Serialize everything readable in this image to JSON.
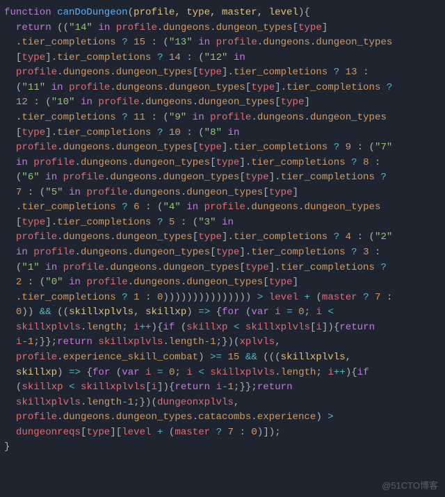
{
  "watermark": "@51CTO博客",
  "code": {
    "l1": {
      "kw1": "function",
      "fn": "canDoDungeon",
      "args": "profile, type, master, level"
    },
    "l2": {
      "kw": "return",
      "s": "\"14\"",
      "in": "in",
      "p1": "profile",
      "d": "dungeons",
      "dt": "dungeon_types",
      "t": "type"
    },
    "l3": {
      "tc": "tier_completions",
      "n15": "15",
      "s13": "\"13\"",
      "in": "in",
      "p": "profile",
      "d": "dungeons",
      "dt": "dungeon_types"
    },
    "l4": {
      "t": "type",
      "tc": "tier_completions",
      "n14": "14",
      "s12": "\"12\"",
      "in": "in"
    },
    "l5": {
      "p": "profile",
      "d": "dungeons",
      "dt": "dungeon_types",
      "t": "type",
      "tc": "tier_completions",
      "n13": "13"
    },
    "l6": {
      "s11": "\"11\"",
      "in": "in",
      "p": "profile",
      "d": "dungeons",
      "dt": "dungeon_types",
      "t": "type",
      "tc": "tier_completions"
    },
    "l7": {
      "n12": "12",
      "s10": "\"10\"",
      "in": "in",
      "p": "profile",
      "d": "dungeons",
      "dt": "dungeon_types",
      "t": "type"
    },
    "l8": {
      "tc": "tier_completions",
      "n11": "11",
      "s9": "\"9\"",
      "in": "in",
      "p": "profile",
      "d": "dungeons",
      "dt": "dungeon_types"
    },
    "l9": {
      "t": "type",
      "tc": "tier_completions",
      "n10": "10",
      "s8": "\"8\"",
      "in": "in"
    },
    "l10": {
      "p": "profile",
      "d": "dungeons",
      "dt": "dungeon_types",
      "t": "type",
      "tc": "tier_completions",
      "n9": "9",
      "s7": "\"7\""
    },
    "l11": {
      "in": "in",
      "p": "profile",
      "d": "dungeons",
      "dt": "dungeon_types",
      "t": "type",
      "tc": "tier_completions",
      "n8": "8"
    },
    "l12": {
      "s6": "\"6\"",
      "in": "in",
      "p": "profile",
      "d": "dungeons",
      "dt": "dungeon_types",
      "t": "type",
      "tc": "tier_completions"
    },
    "l13": {
      "n7": "7",
      "s5": "\"5\"",
      "in": "in",
      "p": "profile",
      "d": "dungeons",
      "dt": "dungeon_types",
      "t": "type"
    },
    "l14": {
      "tc": "tier_completions",
      "n6": "6",
      "s4": "\"4\"",
      "in": "in",
      "p": "profile",
      "d": "dungeons",
      "dt": "dungeon_types"
    },
    "l15": {
      "t": "type",
      "tc": "tier_completions",
      "n5": "5",
      "s3": "\"3\"",
      "in": "in"
    },
    "l16": {
      "p": "profile",
      "d": "dungeons",
      "dt": "dungeon_types",
      "t": "type",
      "tc": "tier_completions",
      "n4": "4",
      "s2": "\"2\""
    },
    "l17": {
      "in": "in",
      "p": "profile",
      "d": "dungeons",
      "dt": "dungeon_types",
      "t": "type",
      "tc": "tier_completions",
      "n3": "3"
    },
    "l18": {
      "s1": "\"1\"",
      "in": "in",
      "p": "profile",
      "d": "dungeons",
      "dt": "dungeon_types",
      "t": "type",
      "tc": "tier_completions"
    },
    "l19": {
      "n2": "2",
      "s0": "\"0\"",
      "in": "in",
      "p": "profile",
      "d": "dungeons",
      "dt": "dungeon_types",
      "t": "type"
    },
    "l20": {
      "tc": "tier_completions",
      "n1": "1",
      "n0": "0",
      "lvl": "level",
      "m": "master",
      "n7": "7"
    },
    "l21": {
      "n0": "0",
      "sx": "skillxplvls",
      "sxp": "skillxp",
      "for": "for",
      "var": "var",
      "i": "i",
      "z": "0"
    },
    "l22": {
      "sx": "skillxplvls",
      "len": "length",
      "i": "i",
      "if": "if",
      "sxp": "skillxp",
      "ret": "return"
    },
    "l23": {
      "i": "i",
      "n1": "1",
      "ret": "return",
      "sx": "skillxplvls",
      "len": "length",
      "xp": "xplvls"
    },
    "l24": {
      "p": "profile",
      "esc": "experience_skill_combat",
      "n15": "15",
      "sx": "skillxplvls"
    },
    "l25": {
      "sxp": "skillxp",
      "for": "for",
      "var": "var",
      "i": "i",
      "z": "0",
      "sx": "skillxplvls",
      "len": "length",
      "if": "if"
    },
    "l26": {
      "sxp": "skillxp",
      "sx": "skillxplvls",
      "i": "i",
      "ret": "return",
      "n1": "1",
      "ret2": "return"
    },
    "l27": {
      "sx": "skillxplvls",
      "len": "length",
      "n1": "1",
      "dx": "dungeonxplvls"
    },
    "l28": {
      "p": "profile",
      "d": "dungeons",
      "dt": "dungeon_types",
      "cat": "catacombs",
      "exp": "experience"
    },
    "l29": {
      "dr": "dungeonreqs",
      "t": "type",
      "lvl": "level",
      "m": "master",
      "n7": "7",
      "n0": "0"
    }
  }
}
